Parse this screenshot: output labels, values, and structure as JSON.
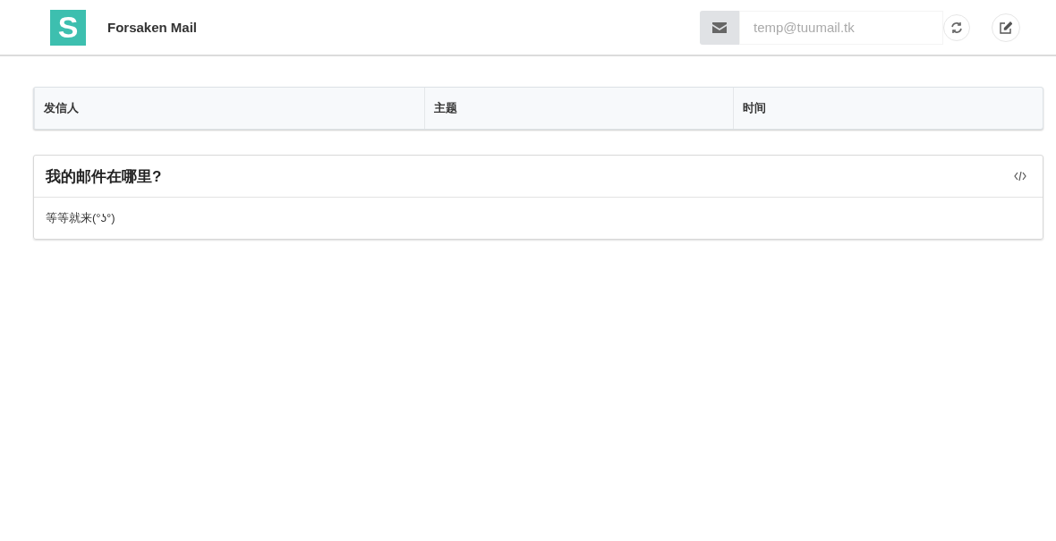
{
  "header": {
    "logo": "S",
    "title": "Forsaken Mail",
    "email_field": {
      "placeholder": "temp@tuumail.tk"
    }
  },
  "table": {
    "columns": [
      "发信人",
      "主题",
      "时间"
    ]
  },
  "panel": {
    "title": "我的邮件在哪里?",
    "body": "等等就来(°ʖ°)"
  }
}
